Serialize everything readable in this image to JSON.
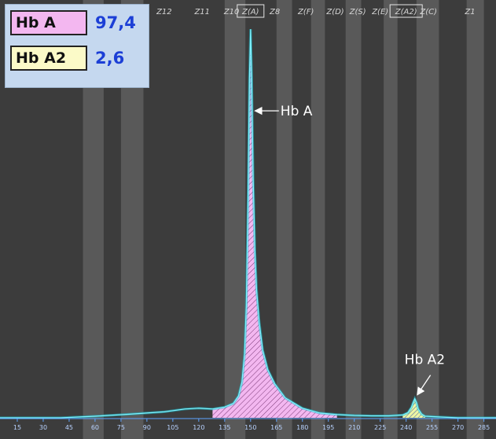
{
  "chart_data": {
    "type": "area",
    "xlim": [
      5,
      292
    ],
    "ylim": [
      0,
      100
    ],
    "x_ticks": [
      15,
      30,
      45,
      60,
      75,
      90,
      105,
      120,
      135,
      150,
      165,
      180,
      195,
      210,
      225,
      240,
      255,
      270,
      285
    ],
    "zones": [
      {
        "label": "Z12",
        "x": 100
      },
      {
        "label": "Z11",
        "x": 122
      },
      {
        "label": "Z10",
        "x": 139
      },
      {
        "label": "Z(A)",
        "x": 150,
        "boxed": true
      },
      {
        "label": "Z8",
        "x": 164
      },
      {
        "label": "Z(F)",
        "x": 182
      },
      {
        "label": "Z(D)",
        "x": 199
      },
      {
        "label": "Z(S)",
        "x": 212
      },
      {
        "label": "Z(E)",
        "x": 225
      },
      {
        "label": "Z(A2)",
        "x": 240,
        "boxed": true
      },
      {
        "label": "Z(C)",
        "x": 253
      },
      {
        "label": "Z1",
        "x": 277
      }
    ],
    "bands": [
      [
        53,
        65
      ],
      [
        75,
        88
      ],
      [
        135,
        147
      ],
      [
        165,
        174
      ],
      [
        185,
        193
      ],
      [
        205,
        214
      ],
      [
        227,
        235
      ],
      [
        246,
        259
      ],
      [
        275,
        285
      ]
    ],
    "peaks": [
      {
        "name": "Hb A",
        "center": 150,
        "height": 97.4,
        "fill": "#f3b7f0"
      },
      {
        "name": "Hb A2",
        "center": 245,
        "height": 4.8,
        "fill": "#eef5a3"
      }
    ],
    "series": [
      {
        "values_x": [
          5,
          40,
          60,
          80,
          100,
          112,
          120,
          128,
          135,
          140,
          143,
          145,
          146.5,
          147.5,
          148.5,
          149.3,
          150,
          150.7,
          151.5,
          152.5,
          153.5,
          155,
          157,
          160,
          164,
          170,
          180,
          190,
          200,
          210,
          220,
          230,
          238,
          241,
          243,
          244,
          245,
          246,
          247,
          249,
          251,
          260,
          270,
          292
        ],
        "values_y": [
          0,
          0,
          0.4,
          0.9,
          1.5,
          2.2,
          2.4,
          2.2,
          2.7,
          3.6,
          5.5,
          9,
          16,
          28,
          55,
          85,
          97.4,
          85,
          60,
          42,
          32,
          24,
          17,
          12,
          8.5,
          5,
          2.4,
          1.2,
          0.8,
          0.6,
          0.5,
          0.5,
          0.7,
          1.3,
          2.6,
          3.8,
          4.8,
          3.8,
          2.2,
          0.9,
          0.4,
          0.2,
          0,
          0
        ]
      }
    ],
    "annotations": [
      {
        "text": "Hb A",
        "peak": 0
      },
      {
        "text": "Hb A2",
        "peak": 1
      }
    ],
    "legend": [
      {
        "label": "Hb A",
        "value": "97,4",
        "color": "#f3b7f0"
      },
      {
        "label": "Hb A2",
        "value": "2,6",
        "color": "#fbfac8"
      }
    ]
  }
}
